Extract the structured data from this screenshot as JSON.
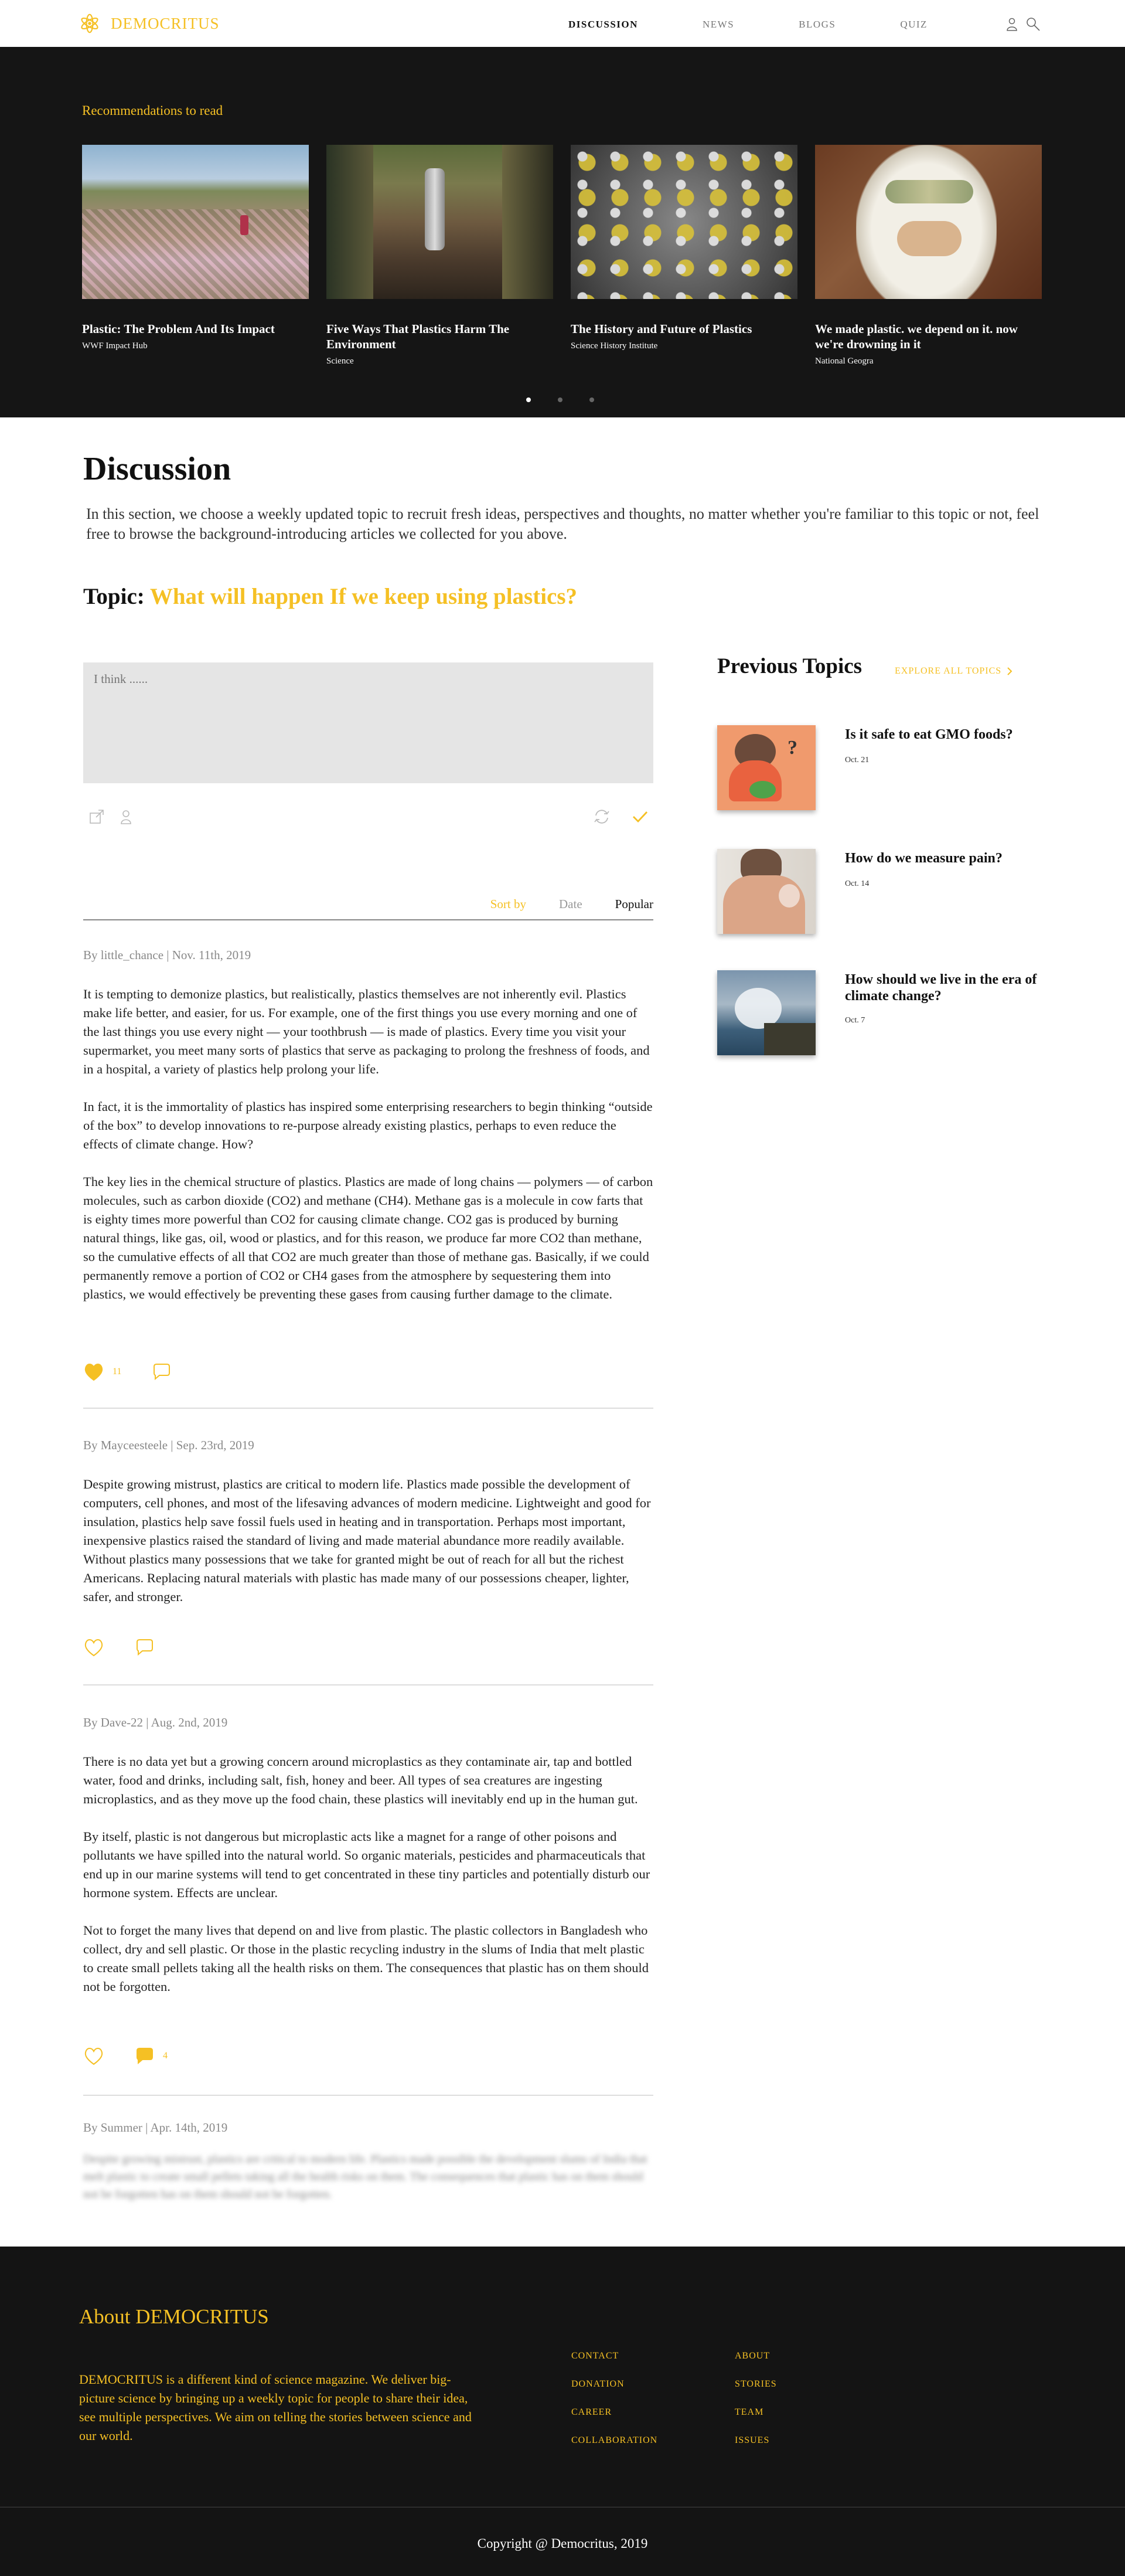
{
  "brand": {
    "name": "DEMOCRITUS",
    "accent": "#f5c024"
  },
  "nav": {
    "items": [
      "DISCUSSION",
      "NEWS",
      "BLOGS",
      "QUIZ"
    ],
    "icons": [
      "user-icon",
      "search-icon"
    ]
  },
  "recommendations": {
    "heading": "Recommendations to read",
    "cards": [
      {
        "title": "Plastic: The Problem And Its Impact",
        "source": "WWF Impact Hub"
      },
      {
        "title": "Five Ways That Plastics Harm The Environment",
        "source": "Science"
      },
      {
        "title": "The History and Future of Plastics",
        "source": "Science History Institute"
      },
      {
        "title": "We made plastic. we depend on it. now we're drowning in it",
        "source": "National Geogra"
      }
    ],
    "carousel_active": 1,
    "carousel_count": 3
  },
  "discussion": {
    "title": "Discussion",
    "description": "In this section, we choose a weekly updated topic to recruit fresh ideas, perspectives and thoughts, no matter whether you're familiar to this topic or not, feel free to browse the background-introducing articles we collected for you above.",
    "topic_label": "Topic:",
    "topic_question": "What will happen If we keep using plastics?",
    "input_placeholder": "I think ......"
  },
  "sort": {
    "label": "Sort by",
    "options": [
      "Date",
      "Popular"
    ],
    "selected": "Popular"
  },
  "comments": [
    {
      "author": "By little_chance | Nov. 11th, 2019",
      "paragraphs": [
        "It is tempting to demonize plastics, but realistically, plastics themselves are not inherently evil. Plastics make life better, and easier, for us. For example, one of the first things you use every morning and one of the last things you use every night — your toothbrush — is made of plastics. Every time you visit your supermarket, you meet many sorts of plastics that serve as packaging to prolong the freshness of foods, and in a hospital, a variety of plastics help prolong your life.",
        "In fact, it is the immortality of plastics has inspired some enterprising researchers to begin thinking “outside of the box” to develop innovations to re-purpose already existing plastics, perhaps to even reduce the effects of climate change. How?",
        "The key lies in the chemical structure of plastics. Plastics are made of long chains — polymers — of carbon molecules, such as carbon dioxide (CO2) and methane (CH4). Methane gas is a molecule in cow farts that is eighty times more powerful than CO2 for causing climate change. CO2 gas is produced by burning natural things, like gas, oil, wood or plastics, and for this reason, we produce far more CO2 than methane, so the cumulative effects of all that CO2 are much greater than those of methane gas. Basically, if we could permanently remove a portion of CO2 or CH4 gases from the atmosphere by sequestering them into plastics, we would effectively be preventing these gases from causing further damage to the climate."
      ],
      "likes": "11",
      "liked": true,
      "replies": ""
    },
    {
      "author": "By Mayceesteele | Sep. 23rd, 2019",
      "paragraphs": [
        "Despite growing mistrust, plastics are critical to modern life. Plastics made possible the development of computers, cell phones, and most of the lifesaving advances of modern medicine. Lightweight and good for insulation, plastics help save fossil fuels used in heating and in transportation. Perhaps most important, inexpensive plastics raised the standard of living and made material abundance more readily available. Without plastics many possessions that we take for granted might be out of reach for all but the richest Americans. Replacing natural materials with plastic has made many of our possessions cheaper, lighter, safer, and stronger."
      ],
      "likes": "",
      "liked": false,
      "replies": ""
    },
    {
      "author": "By Dave-22 | Aug. 2nd, 2019",
      "paragraphs": [
        "There is no data yet but a growing concern around microplastics as they contaminate air, tap and bottled water, food and drinks, including salt, fish, honey and beer. All types of sea creatures are ingesting microplastics, and as they move up the food chain, these plastics will inevitably end up in the human gut.",
        "By itself, plastic is not dangerous but microplastic acts like a magnet for a range of other poisons and pollutants we have spilled into the natural world. So organic materials, pesticides and pharmaceuticals that end up in our marine systems will tend to get concentrated in these tiny particles and potentially disturb our hormone system. Effects are unclear.",
        "Not to forget the many lives that depend on and live from plastic. The plastic collectors in Bangladesh who collect, dry and sell plastic. Or those in the plastic recycling industry in the slums of India that melt plastic to create small pellets taking all the health risks on them. The consequences that plastic has on them should not be forgotten."
      ],
      "likes": "",
      "liked": false,
      "replies": "4"
    },
    {
      "author": "By Summer | Apr. 14th, 2019",
      "paragraphs": [
        "Despite growing mistrust, plastics are critical to modern life. Plastics made possible the development slums of India that melt plastic to create small pellets taking all the health risks on them. The consequences that plastic has on them should not be forgotten has on them should not be forgotten."
      ]
    }
  ],
  "previous_topics": {
    "heading": "Previous Topics",
    "explore_label": "EXPLORE ALL TOPICS",
    "items": [
      {
        "title": "Is it safe to eat GMO foods?",
        "date": "Oct. 21"
      },
      {
        "title": "How do we measure pain?",
        "date": "Oct. 14"
      },
      {
        "title": "How should we live in the era of climate change?",
        "date": "Oct. 7"
      }
    ]
  },
  "footer": {
    "about_title": "About DEMOCRITUS",
    "about_text": "DEMOCRITUS is a different kind of science magazine. We deliver big-picture science by bringing up a weekly topic for people to share their idea, see multiple perspectives. We aim on telling the stories between science and our world.",
    "links_col1": [
      "CONTACT",
      "DONATION",
      "CAREER",
      "COLLABORATION"
    ],
    "links_col2": [
      "ABOUT",
      "STORIES",
      "TEAM",
      "ISSUES"
    ],
    "copyright": "Copyright @ Democritus, 2019"
  }
}
